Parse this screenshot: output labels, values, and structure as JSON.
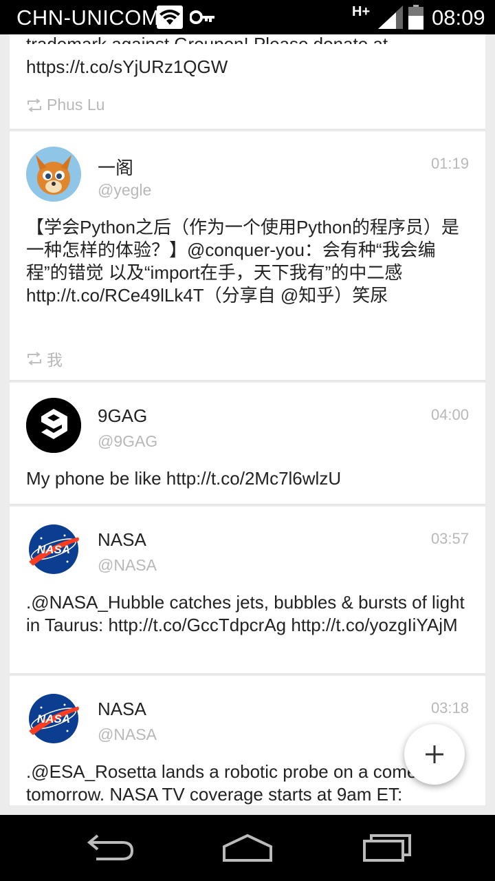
{
  "status_bar": {
    "carrier": "CHN-UNICOM",
    "network_type": "H+",
    "time": "08:09"
  },
  "timeline": {
    "partial_top": {
      "text_cut": "trademark against Groupon! Please donate at",
      "text": "https://t.co/sYjURz1QGW",
      "retweeted_by": "Phus Lu"
    },
    "tweets": [
      {
        "name": "一阁",
        "handle": "@yegle",
        "time": "01:19",
        "text": "【学会Python之后（作为一个使用Python的程序员）是一种怎样的体验？】@conquer-you：会有种“我会编程”的错觉 以及“import在手，天下我有”的中二感 http://t.co/RCe49lLk4T（分享自 @知乎）笑尿",
        "retweeted_by": "我",
        "avatar_icon": "fox-avatar"
      },
      {
        "name": "9GAG",
        "handle": "@9GAG",
        "time": "04:00",
        "text": "My phone be like http://t.co/2Mc7l6wlzU",
        "avatar_icon": "9gag-logo"
      },
      {
        "name": "NASA",
        "handle": "@NASA",
        "time": "03:57",
        "text": ".@NASA_Hubble catches jets, bubbles & bursts of light in Taurus: http://t.co/GccTdpcrAg http://t.co/yozgIiYAjM",
        "avatar_icon": "nasa-logo"
      },
      {
        "name": "NASA",
        "handle": "@NASA",
        "time": "03:18",
        "text": ".@ESA_Rosetta lands a robotic probe on a comet tomorrow. NASA TV coverage starts at 9am ET:",
        "avatar_icon": "nasa-logo"
      }
    ]
  },
  "fab": {
    "icon": "plus-icon"
  },
  "nav_bar": {
    "icons": [
      "back-icon",
      "home-icon",
      "recents-icon"
    ]
  }
}
